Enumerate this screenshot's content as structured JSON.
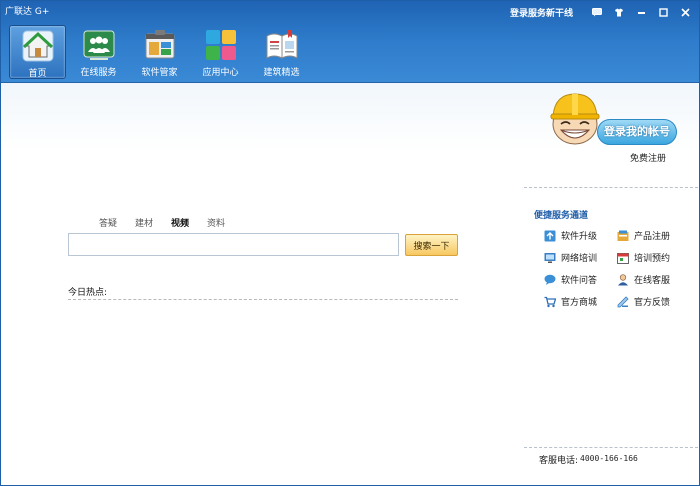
{
  "app": {
    "title": "广联达 G+"
  },
  "topbar": {
    "login_news": "登录服务新干线",
    "buttons": [
      {
        "name": "message-icon"
      },
      {
        "name": "skin-icon"
      },
      {
        "name": "minimize-icon"
      },
      {
        "name": "maximize-icon"
      },
      {
        "name": "close-icon"
      }
    ]
  },
  "nav": {
    "items": [
      {
        "label": "首页",
        "icon": "home-icon",
        "active": true
      },
      {
        "label": "在线服务",
        "icon": "online-service-icon"
      },
      {
        "label": "软件管家",
        "icon": "software-manager-icon"
      },
      {
        "label": "应用中心",
        "icon": "app-center-icon"
      },
      {
        "label": "建筑精选",
        "icon": "building-picks-icon"
      }
    ]
  },
  "search": {
    "tabs": [
      {
        "label": "答疑"
      },
      {
        "label": "建材"
      },
      {
        "label": "视频",
        "active": true
      },
      {
        "label": "资料"
      }
    ],
    "input_value": "",
    "button_label": "搜索一下"
  },
  "hot": {
    "label": "今日热点:"
  },
  "account": {
    "login_label": "登录我的帐号",
    "register_label": "免费注册"
  },
  "quick": {
    "title": "便捷服务通道",
    "items": [
      {
        "label": "软件升级",
        "icon": "upgrade-icon"
      },
      {
        "label": "产品注册",
        "icon": "product-register-icon"
      },
      {
        "label": "网络培训",
        "icon": "online-training-icon"
      },
      {
        "label": "培训预约",
        "icon": "training-booking-icon"
      },
      {
        "label": "软件问答",
        "icon": "qa-bubble-icon"
      },
      {
        "label": "在线客服",
        "icon": "customer-service-icon"
      },
      {
        "label": "官方商城",
        "icon": "shop-cart-icon"
      },
      {
        "label": "官方反馈",
        "icon": "feedback-icon"
      }
    ]
  },
  "hotline": {
    "label": "客服电话:",
    "number": "4000-166-166"
  },
  "colors": {
    "topbar": "#2e7ccb",
    "accent": "#1f5da8",
    "search_button": "#f7c862"
  }
}
